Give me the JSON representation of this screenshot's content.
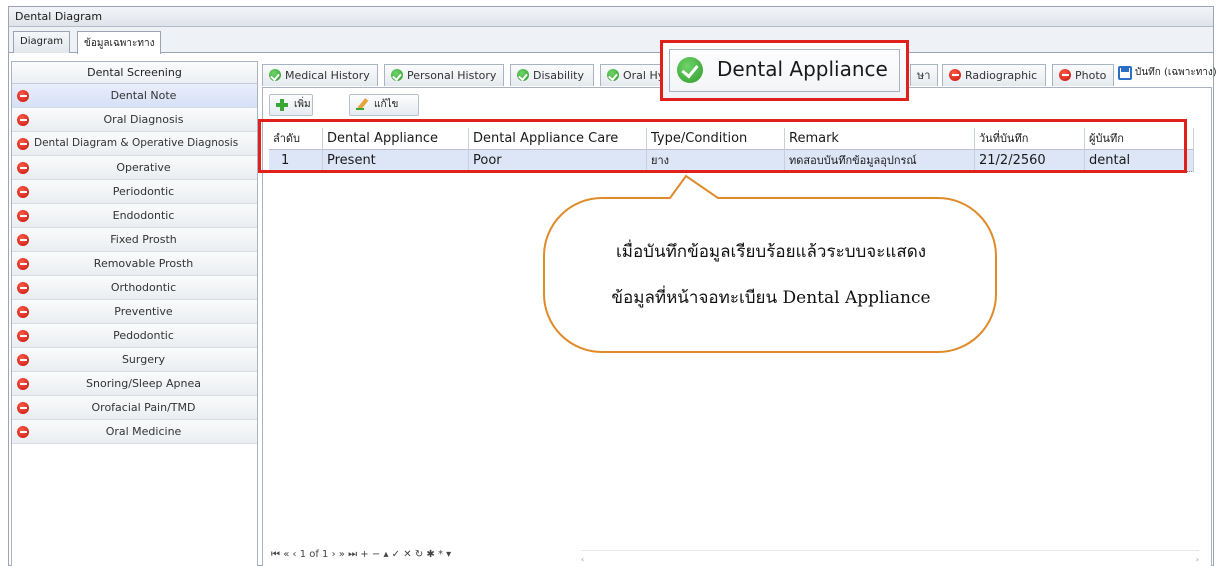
{
  "window": {
    "title": "Dental Diagram"
  },
  "main_tabs": [
    {
      "label": "Diagram"
    },
    {
      "label": "ข้อมูลเฉพาะทาง"
    }
  ],
  "sidebar": {
    "header": "Dental Screening",
    "items": [
      {
        "label": "Dental Note"
      },
      {
        "label": "Oral Diagnosis"
      },
      {
        "label": "Dental Diagram & Operative Diagnosis"
      },
      {
        "label": "Operative"
      },
      {
        "label": "Periodontic"
      },
      {
        "label": "Endodontic"
      },
      {
        "label": "Fixed Prosth"
      },
      {
        "label": "Removable Prosth"
      },
      {
        "label": "Orthodontic"
      },
      {
        "label": "Preventive"
      },
      {
        "label": "Pedodontic"
      },
      {
        "label": "Surgery"
      },
      {
        "label": "Snoring/Sleep Apnea"
      },
      {
        "label": "Orofacial Pain/TMD"
      },
      {
        "label": "Oral Medicine"
      }
    ]
  },
  "sub_tabs": [
    {
      "label": "Medical History",
      "status": "ok"
    },
    {
      "label": "Personal History",
      "status": "ok"
    },
    {
      "label": "Disability",
      "status": "ok"
    },
    {
      "label": "Oral Hyg",
      "status": "ok"
    },
    {
      "label": "ษา",
      "status": "partial"
    },
    {
      "label": "Radiographic",
      "status": "stop"
    },
    {
      "label": "Photo",
      "status": "stop"
    }
  ],
  "save_button": {
    "label": "บันทึก (เฉพาะทาง)"
  },
  "zoomed_tab": {
    "label": "Dental Appliance"
  },
  "toolbar": {
    "add_label": "เพิ่ม",
    "edit_label": "แก้ไข"
  },
  "grid": {
    "columns": [
      "ลำดับ",
      "Dental Appliance",
      "Dental Appliance Care",
      "Type/Condition",
      "Remark",
      "วันที่บันทึก",
      "ผู้บันทึก"
    ],
    "rows": [
      [
        "1",
        "Present",
        "Poor",
        "ยาง",
        "ทดสอบบันทึกข้อมูลอุปกรณ์",
        "21/2/2560",
        "dental"
      ]
    ]
  },
  "navigator": {
    "record_text": "1 of 1"
  },
  "callout": {
    "line1": "เมื่อบันทึกข้อมูลเรียบร้อยแล้วระบบจะแสดง",
    "line2": "ข้อมูลที่หน้าจอทะเบียน Dental Appliance"
  },
  "colors": {
    "highlight_red": "#e0211b",
    "callout_border": "#e08b2a",
    "ok_green": "#2e9a2a",
    "stop_red": "#c5120a",
    "selected_row": "#dde6f7"
  }
}
